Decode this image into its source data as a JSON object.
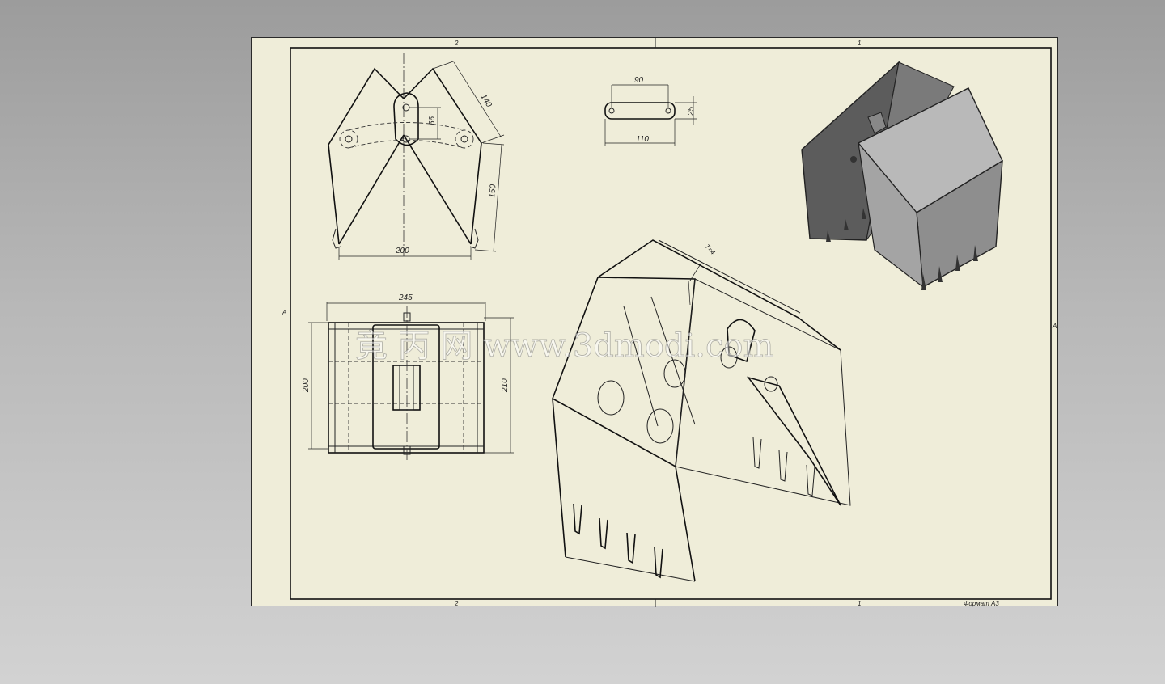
{
  "sheet": {
    "zone_top_left": "2",
    "zone_top_right": "1",
    "zone_bottom_left": "2",
    "zone_bottom_right": "1",
    "zone_left": "A",
    "zone_right": "A",
    "format_label": "Формат А3"
  },
  "views": {
    "front": {
      "dims": {
        "slant": "140",
        "pin_offset": "66",
        "height": "150",
        "width": "200"
      }
    },
    "link_plate": {
      "dims": {
        "hole_spacing": "90",
        "height": "25",
        "length": "110"
      }
    },
    "top": {
      "dims": {
        "width": "245",
        "depth_left": "200",
        "depth_right": "210"
      }
    },
    "isometric": {
      "dims": {
        "wall": "Т=4"
      }
    }
  },
  "watermark": "竟 丙 网 www.3dmodi.com",
  "colors": {
    "sheet": "#efedd9",
    "background": "#a8a8a8",
    "line": "#111111",
    "shaded_model": "#555555"
  }
}
